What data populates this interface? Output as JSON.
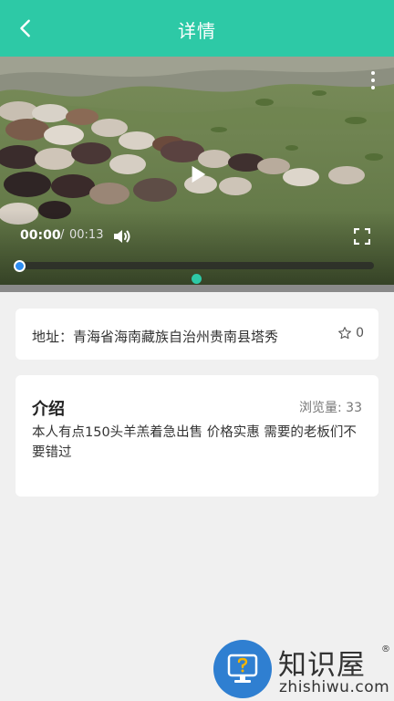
{
  "header": {
    "back_icon": "chevron-left-icon",
    "title": "详情",
    "color": "#2dc9a6"
  },
  "video": {
    "current_time": "00:00",
    "separator": "/",
    "total_time": "00:13",
    "icons": [
      "play-icon",
      "volume-icon",
      "fullscreen-icon",
      "more-vertical-icon"
    ],
    "progress": 0,
    "seek_color": "#2d8cf0"
  },
  "address": {
    "label": "地址：",
    "value": "青海省海南藏族自治州贵南县塔秀",
    "favorite_icon": "star-outline-icon",
    "favorite_count": "0"
  },
  "intro": {
    "title": "介绍",
    "views_label": "浏览量:",
    "views_count": "33",
    "body": "本人有点150头羊羔着急出售 价格实惠 需要的老板们不要错过"
  },
  "watermark": {
    "logo_icon": "question-monitor-icon",
    "name": "知识屋",
    "registered": "®",
    "url": "zhishiwu.com",
    "color": "#2f7fd1"
  }
}
